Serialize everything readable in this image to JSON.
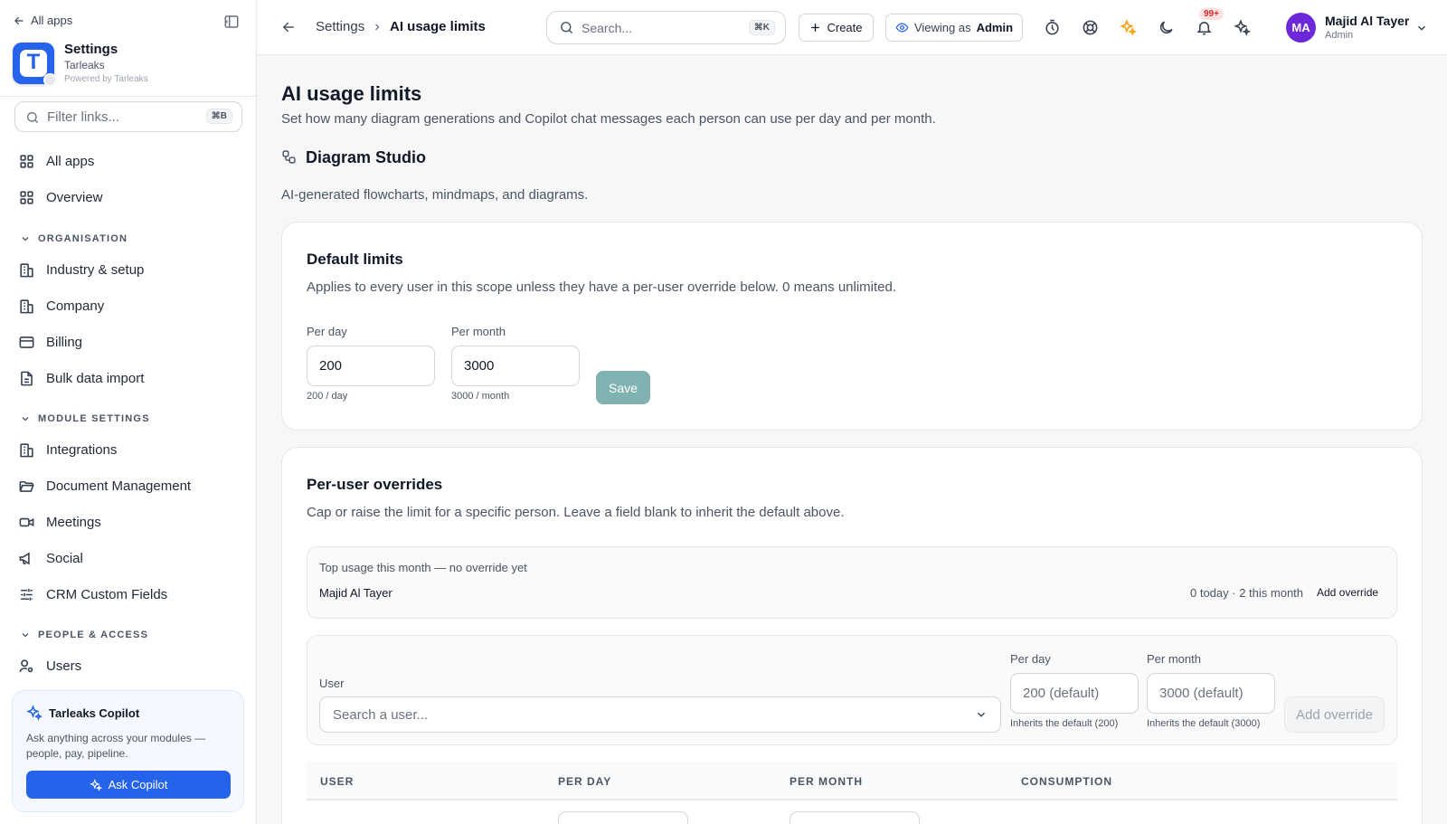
{
  "sidebar": {
    "all_apps_link": "All apps",
    "org_name": "Settings",
    "org_sub": "Tarleaks",
    "org_powered": "Powered by Tarleaks",
    "logo_letter": "T",
    "filter_placeholder": "Filter links...",
    "filter_shortcut": "⌘B",
    "items": {
      "all_apps": "All apps",
      "overview": "Overview",
      "industry": "Industry & setup",
      "company": "Company",
      "billing": "Billing",
      "bulk_import": "Bulk data import",
      "integrations": "Integrations",
      "document_mgmt": "Document Management",
      "meetings": "Meetings",
      "social": "Social",
      "crm_fields": "CRM Custom Fields",
      "users": "Users"
    },
    "sections": {
      "organisation": "ORGANISATION",
      "module_settings": "MODULE SETTINGS",
      "people_access": "PEOPLE & ACCESS"
    },
    "copilot": {
      "title": "Tarleaks Copilot",
      "desc": "Ask anything across your modules — people, pay, pipeline.",
      "button": "Ask Copilot"
    }
  },
  "topbar": {
    "breadcrumb_root": "Settings",
    "breadcrumb_current": "AI usage limits",
    "search_placeholder": "Search...",
    "search_shortcut": "⌘K",
    "create_label": "Create",
    "viewing_prefix": "Viewing as",
    "viewing_role": "Admin",
    "notif_count": "99+",
    "user_initials": "MA",
    "user_name": "Majid Al Tayer",
    "user_role": "Admin"
  },
  "main": {
    "title": "AI usage limits",
    "desc": "Set how many diagram generations and Copilot chat messages each person can use per day and per month.",
    "module_title": "Diagram Studio",
    "module_desc": "AI-generated flowcharts, mindmaps, and diagrams.",
    "defaults": {
      "title": "Default limits",
      "desc": "Applies to every user in this scope unless they have a per-user override below. 0 means unlimited.",
      "per_day_label": "Per day",
      "per_day_value": "200",
      "per_day_hint": "200 / day",
      "per_month_label": "Per month",
      "per_month_value": "3000",
      "per_month_hint": "3000 / month",
      "save_label": "Save"
    },
    "overrides": {
      "title": "Per-user overrides",
      "desc": "Cap or raise the limit for a specific person. Leave a field blank to inherit the default above.",
      "top_usage_label": "Top usage this month — no override yet",
      "top_user_name": "Majid Al Tayer",
      "top_user_usage": "0 today · 2 this month",
      "top_user_action": "Add override",
      "user_label": "User",
      "user_placeholder": "Search a user...",
      "per_day_label": "Per day",
      "per_day_placeholder": "200 (default)",
      "per_day_hint": "Inherits the default (200)",
      "per_month_label": "Per month",
      "per_month_placeholder": "3000 (default)",
      "per_month_hint": "Inherits the default (3000)",
      "add_button": "Add override",
      "columns": [
        "USER",
        "PER DAY",
        "PER MONTH",
        "CONSUMPTION"
      ]
    }
  }
}
